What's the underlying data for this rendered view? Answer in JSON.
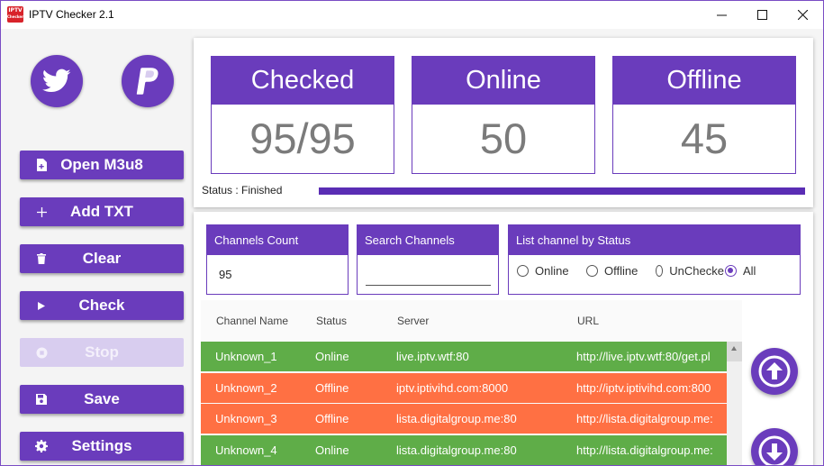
{
  "window": {
    "title": "IPTV Checker 2.1",
    "icon_text_line1": "IPTV",
    "icon_text_line2": "Checker"
  },
  "sidebar": {
    "social": [
      {
        "name": "twitter-icon"
      },
      {
        "name": "paypal-icon"
      }
    ],
    "buttons": {
      "open": "Open M3u8",
      "add_txt": "Add TXT",
      "clear": "Clear",
      "check": "Check",
      "stop": "Stop",
      "save": "Save",
      "settings": "Settings"
    }
  },
  "stats": {
    "checked_label": "Checked",
    "checked_value": "95/95",
    "online_label": "Online",
    "online_value": "50",
    "offline_label": "Offline",
    "offline_value": "45"
  },
  "status": {
    "text": "Status : Finished",
    "progress": 1.0
  },
  "filters": {
    "channels_count_label": "Channels Count",
    "channels_count_value": "95",
    "search_label": "Search Channels",
    "search_value": "",
    "list_by_status_label": "List channel by Status",
    "options": [
      "Online",
      "Offline",
      "UnChecke",
      "All"
    ],
    "selected": "All"
  },
  "table": {
    "headers": [
      "Channel Name",
      "Status",
      "Server",
      "URL"
    ],
    "rows": [
      {
        "name": "Unknown_1",
        "status": "Online",
        "server": "live.iptv.wtf:80",
        "url": "http://live.iptv.wtf:80/get.pl"
      },
      {
        "name": "Unknown_2",
        "status": "Offline",
        "server": "iptv.iptivihd.com:8000",
        "url": "http://iptv.iptivihd.com:800"
      },
      {
        "name": "Unknown_3",
        "status": "Offline",
        "server": "lista.digitalgroup.me:80",
        "url": "http://lista.digitalgroup.me:"
      },
      {
        "name": "Unknown_4",
        "status": "Online",
        "server": "lista.digitalgroup.me:80",
        "url": "http://lista.digitalgroup.me:"
      }
    ]
  },
  "colors": {
    "accent": "#6a3cbc",
    "online": "#5fad48",
    "offline": "#ff7043"
  }
}
